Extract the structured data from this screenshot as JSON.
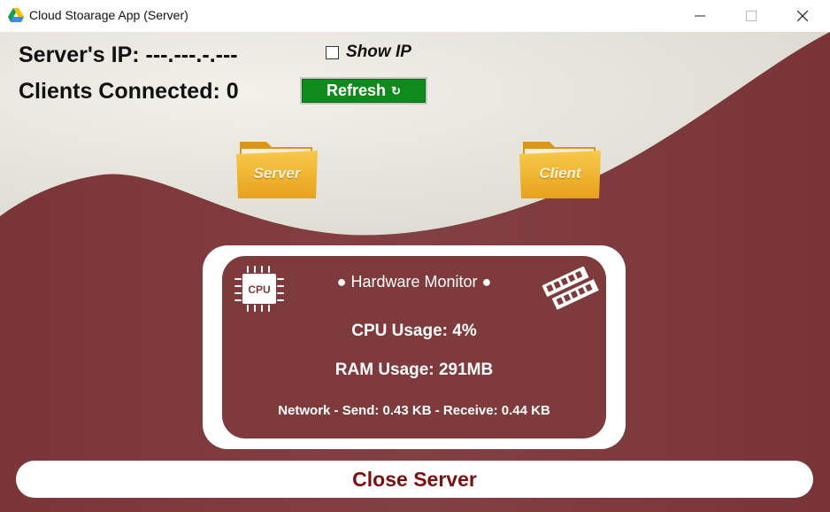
{
  "window": {
    "title": "Cloud Stoarage App (Server)",
    "icon": "google-drive-icon"
  },
  "header": {
    "server_ip_label": "Server's IP: ---.---.-.---",
    "clients_label": "Clients Connected: 0",
    "show_ip_label": "Show IP",
    "show_ip_checked": false,
    "refresh_label": "Refresh",
    "refresh_icon": "↻"
  },
  "folders": {
    "server_label": "Server",
    "client_label": "Client"
  },
  "monitor": {
    "title": "● Hardware Monitor ●",
    "cpu_icon_text": "CPU",
    "cpu_usage": "CPU Usage: 4%",
    "ram_usage": "RAM Usage: 291MB",
    "network": "Network - Send: 0.43 KB - Receive: 0.44 KB"
  },
  "footer": {
    "close_label": "Close Server"
  },
  "colors": {
    "maroon": "#7f3a3c",
    "cream": "#e8e6dc",
    "refresh_green": "#0f8a1c",
    "close_text": "#7c0f10",
    "folder_yellow": "#f2b52a"
  }
}
